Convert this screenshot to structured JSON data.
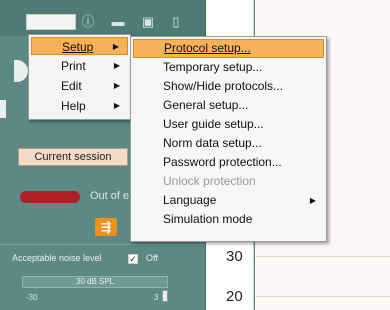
{
  "left_panel": {
    "toolbar_icons": [
      "help-icon",
      "printer-icon",
      "save-icon",
      "document-icon"
    ],
    "current_session_label": "Current session",
    "out_text": "Out of e",
    "orange_button_icon": "export-icon",
    "noise": {
      "label": "Acceptable noise level",
      "checkbox_checked": true,
      "checkbox_mark": "✓",
      "state": "Off"
    },
    "slider": {
      "value_text": "30 dB SPL",
      "min": "-30",
      "max": "3"
    }
  },
  "chart": {
    "ticks": [
      "30",
      "20"
    ]
  },
  "main_menu": {
    "items": [
      {
        "label": "Setup",
        "arrow": "▶"
      },
      {
        "label": "Print",
        "arrow": "▶"
      },
      {
        "label": "Edit",
        "arrow": "▶"
      },
      {
        "label": "Help",
        "arrow": "▶"
      }
    ]
  },
  "setup_submenu": {
    "items": [
      {
        "label": "Protocol setup..."
      },
      {
        "label": "Temporary setup..."
      },
      {
        "label": "Show/Hide protocols..."
      },
      {
        "label": "General setup..."
      },
      {
        "label": "User guide setup..."
      },
      {
        "label": "Norm data setup..."
      },
      {
        "label": "Password protection..."
      },
      {
        "label": "Unlock protection"
      },
      {
        "label": "Language",
        "arrow": "▶"
      },
      {
        "label": "Simulation mode"
      }
    ]
  },
  "colors": {
    "menu_highlight": "#f7b159",
    "panel": "#5d8985",
    "accent_orange": "#ef8f1d",
    "red_indicator": "#b01e26"
  }
}
